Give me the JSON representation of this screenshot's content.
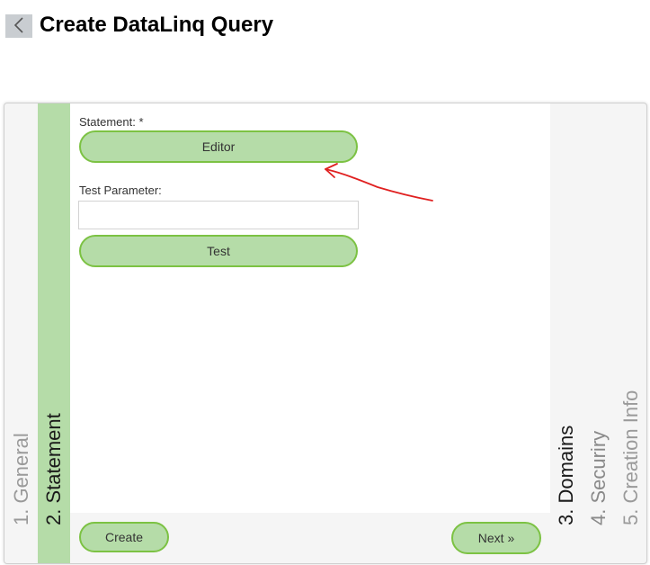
{
  "header": {
    "title": "Create DataLinq Query"
  },
  "steps": [
    {
      "label": "1.  General",
      "state": "inactive"
    },
    {
      "label": "2.  Statement",
      "state": "active"
    },
    {
      "label": "3.  Domains",
      "state": "pending"
    },
    {
      "label": "4.  Securiry",
      "state": "inactive"
    },
    {
      "label": "5.  Creation Info",
      "state": "inactive"
    }
  ],
  "form": {
    "statement_label": "Statement: *",
    "editor_button": "Editor",
    "test_parameter_label": "Test Parameter:",
    "test_parameter_value": "",
    "test_button": "Test"
  },
  "footer": {
    "create_button": "Create",
    "next_button": "Next »"
  },
  "colors": {
    "accent_fill": "#b5dca8",
    "accent_border": "#7cc243",
    "annotation_arrow": "#e02020"
  },
  "icons": {
    "back": "chevron-left-icon"
  }
}
